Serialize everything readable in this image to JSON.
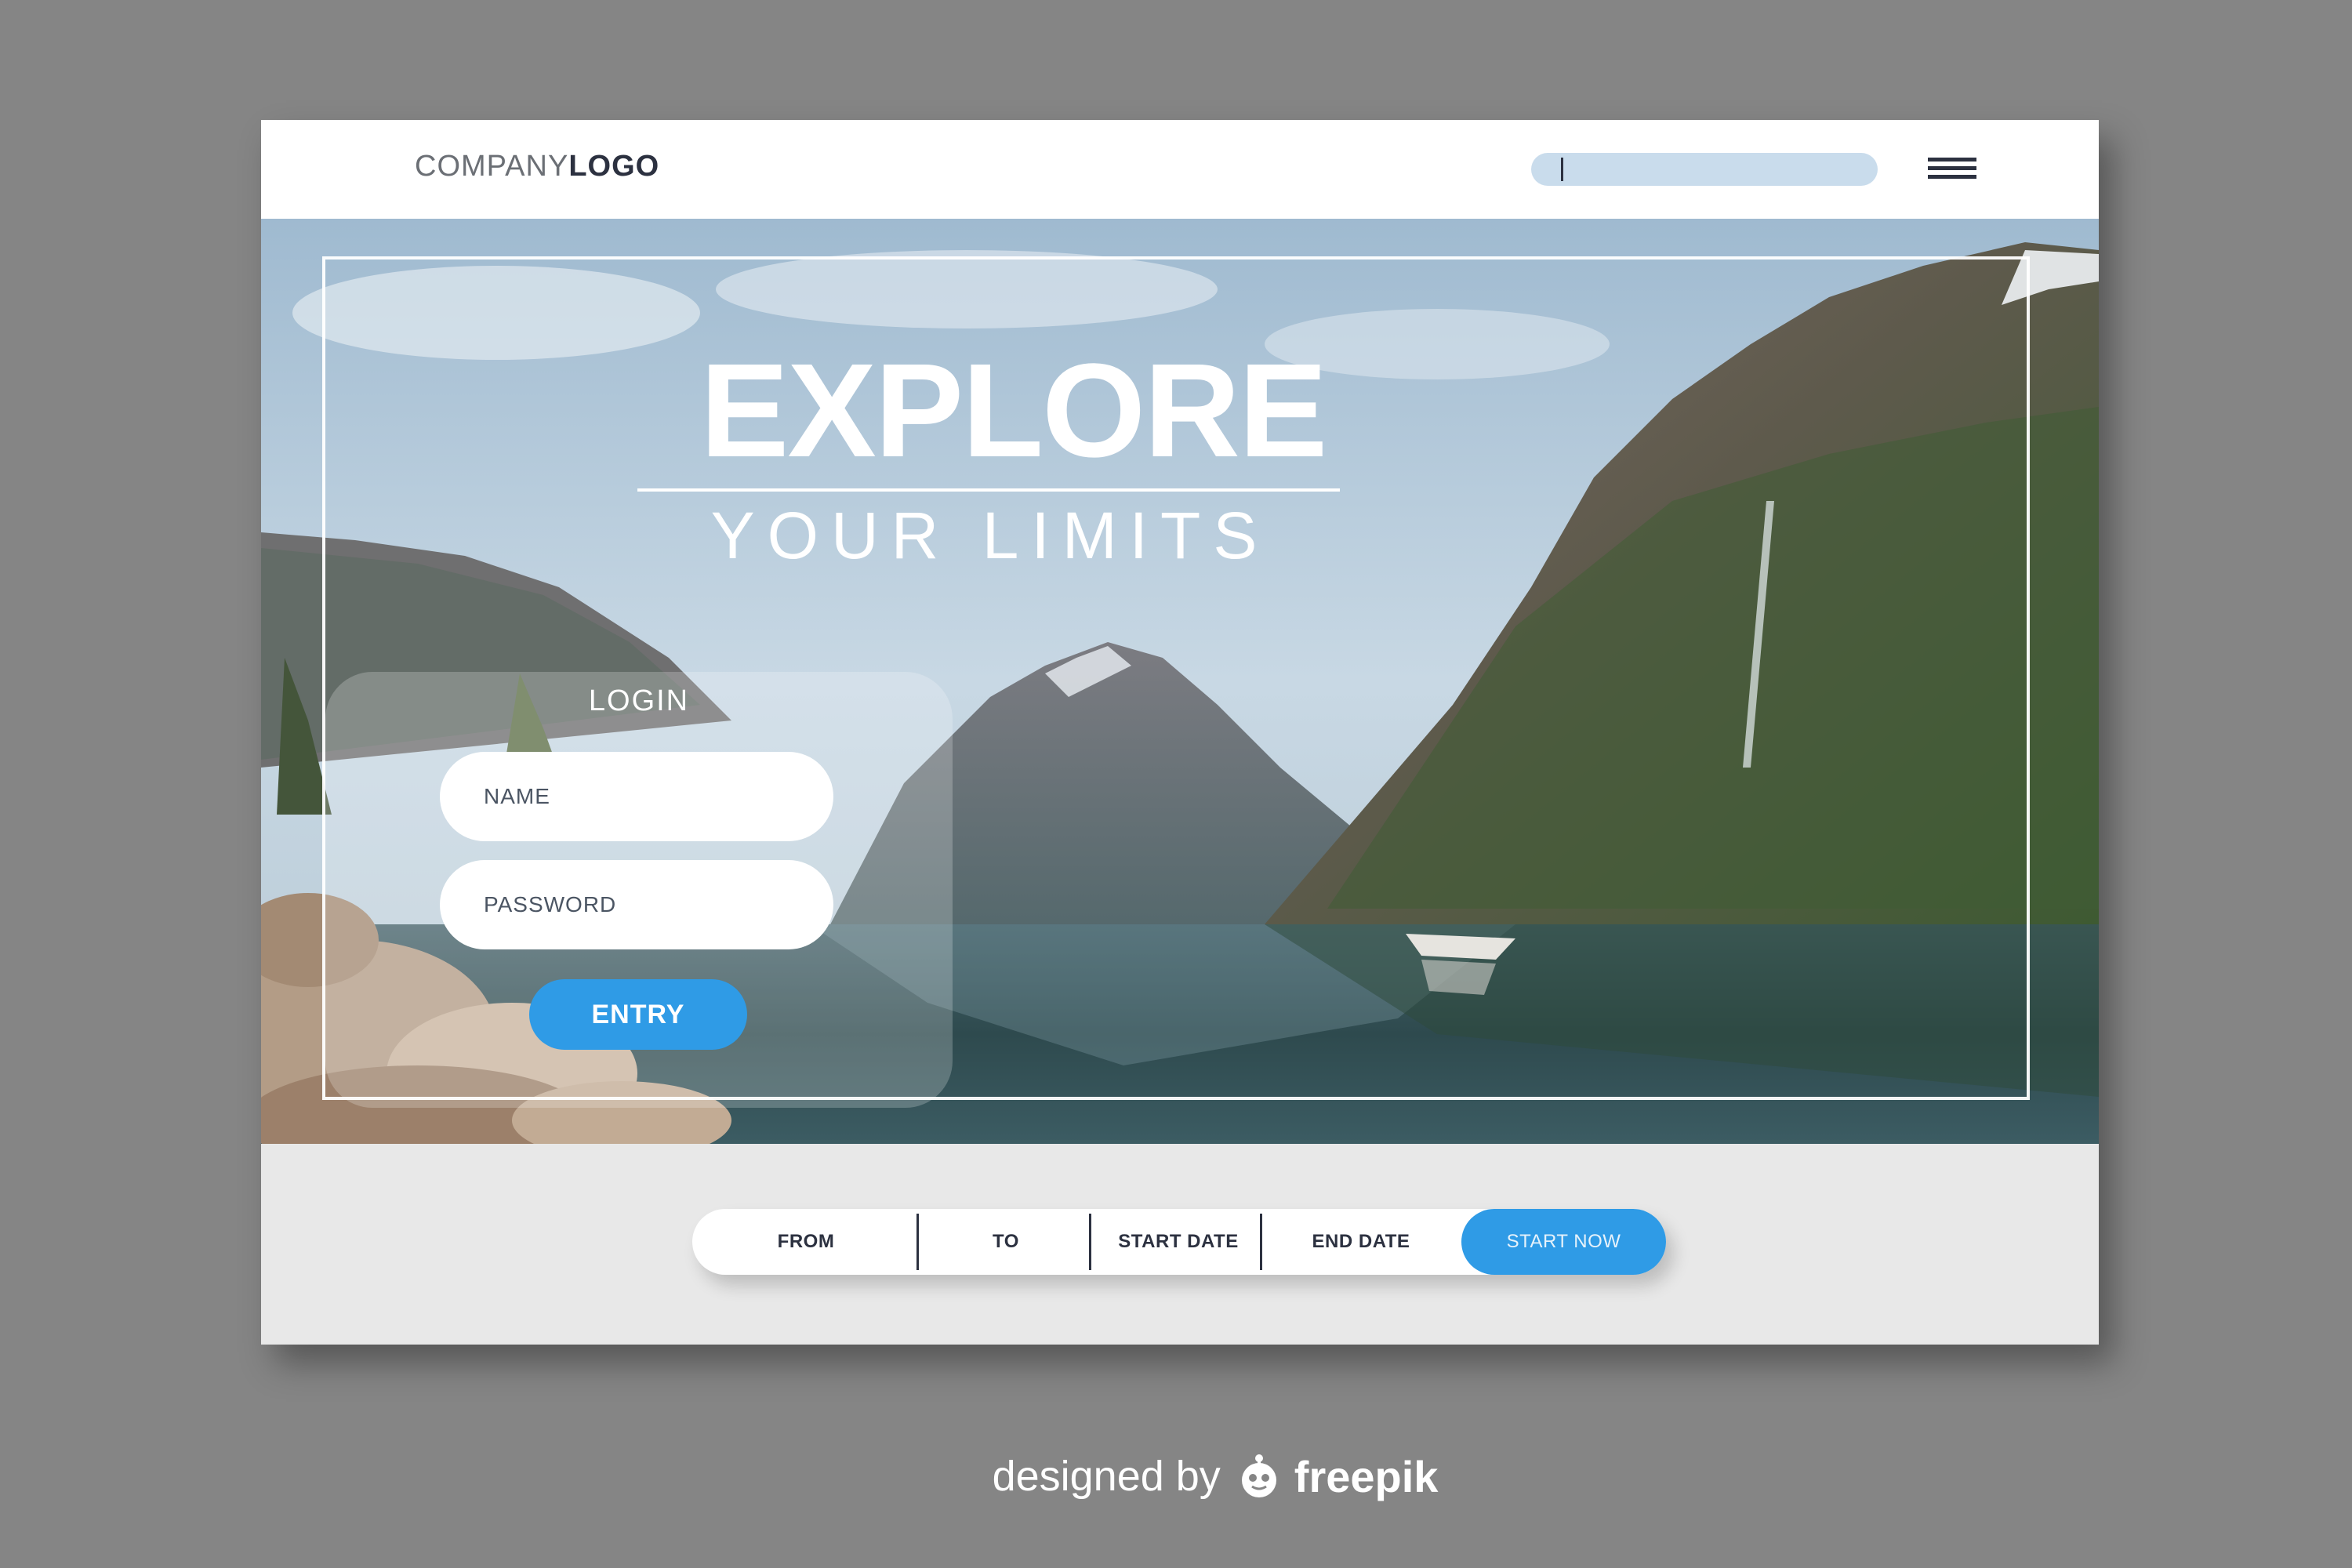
{
  "navbar": {
    "logo_light": "COMPANY",
    "logo_bold": "LOGO",
    "search_value": ""
  },
  "hero": {
    "title": "EXPLORE",
    "subtitle": "YOUR LIMITS"
  },
  "login": {
    "title": "LOGIN",
    "name_placeholder": "NAME",
    "password_placeholder": "PASSWORD",
    "entry_label": "ENTRY"
  },
  "booking": {
    "from_label": "FROM",
    "to_label": "TO",
    "start_date_label": "START DATE",
    "end_date_label": "END DATE",
    "start_now_label": "START NOW"
  },
  "credit": {
    "designed_by": "designed by",
    "brand": "freepik"
  },
  "colors": {
    "accent": "#2f9be6",
    "search_bg": "#c9dcec",
    "dark_text": "#2c3140",
    "page_bg": "#858585"
  }
}
